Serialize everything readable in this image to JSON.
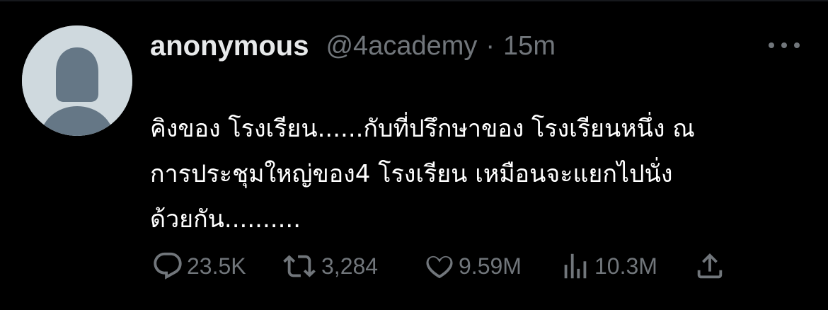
{
  "user": {
    "display_name": "anonymous",
    "handle": "@4academy",
    "separator": "·",
    "timestamp": "15m"
  },
  "tweet": {
    "lines": [
      "คิงของ โรงเรียน......กับที่ปรึกษาของ โรงเรียนหนึ่ง  ณ",
      "การประชุมใหญ่ของ4 โรงเรียน เหมือนจะแยกไปนั่ง",
      "ด้วยกัน.........."
    ]
  },
  "metrics": {
    "replies": "23.5K",
    "retweets": "3,284",
    "likes": "9.59M",
    "views": "10.3M"
  },
  "icons": {
    "more": "more-dots-icon",
    "reply": "reply-bubble-icon",
    "retweet": "retweet-icon",
    "like": "heart-icon",
    "views": "bar-chart-icon",
    "share": "share-upload-icon"
  },
  "colors": {
    "background": "#000000",
    "primary_text": "#e7e9ea",
    "secondary_text": "#71767b",
    "avatar_bg": "#cfd9de",
    "avatar_fg": "#657786"
  }
}
